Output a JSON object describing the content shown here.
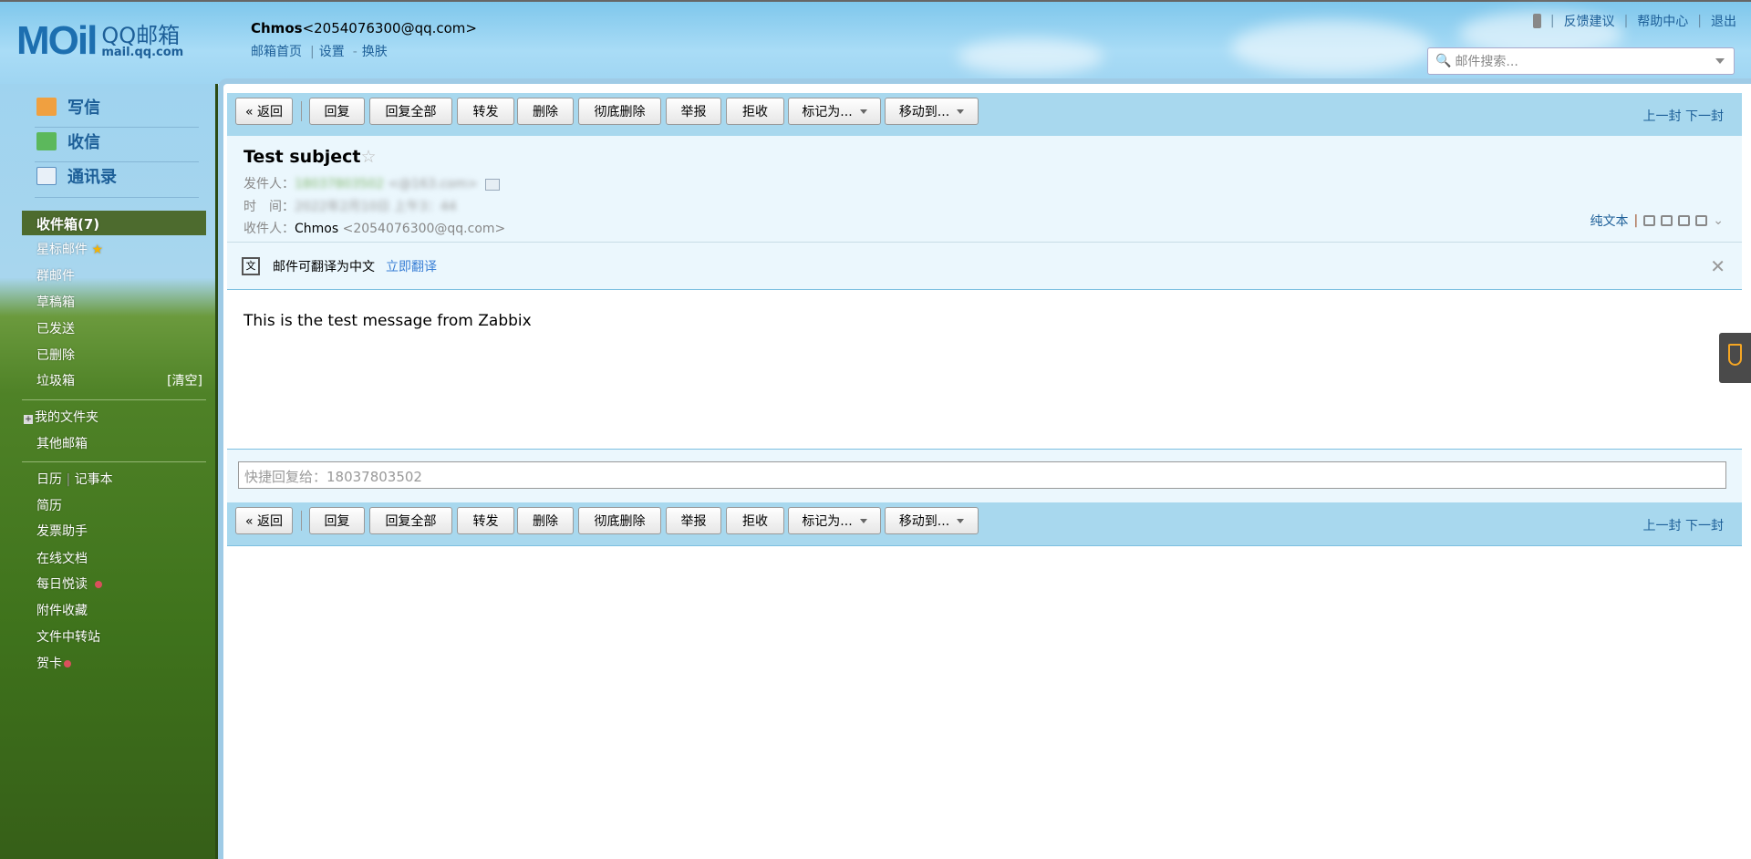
{
  "header": {
    "logo_text": "MOil",
    "logo_brand": "QQ邮箱",
    "logo_domain": "mail.qq.com",
    "user_name": "Chmos",
    "user_email": "<2054076300@qq.com>",
    "links": [
      "邮箱首页",
      "设置",
      "换肤"
    ],
    "right_links": [
      "反馈建议",
      "帮助中心",
      "退出"
    ],
    "search_placeholder": "邮件搜索..."
  },
  "sidebar": {
    "nav": [
      "写信",
      "收信",
      "通讯录"
    ],
    "folders": [
      "收件箱(7)",
      "星标邮件",
      "群邮件",
      "草稿箱",
      "已发送",
      "已删除",
      "垃圾箱"
    ],
    "clear_label": "[清空]",
    "group2": [
      "我的文件夹",
      "其他邮箱"
    ],
    "apps": [
      "日历",
      "记事本",
      "简历",
      "发票助手",
      "在线文档",
      "每日悦读",
      "附件收藏",
      "文件中转站",
      "贺卡"
    ]
  },
  "toolbar": {
    "buttons": [
      "« 返回",
      "回复",
      "回复全部",
      "转发",
      "删除",
      "彻底删除",
      "举报",
      "拒收",
      "标记为...",
      "移动到..."
    ],
    "prev": "上一封",
    "next": "下一封"
  },
  "mail": {
    "subject": "Test subject",
    "from_label": "发件人：",
    "from_name": "18037803502",
    "from_email": "<@163.com>",
    "time_label": "时　间：",
    "time_value": "2022年2月10日 上午3：44",
    "to_label": "收件人：",
    "to_name": "Chmos",
    "to_email": "<2054076300@qq.com>",
    "plain_text": "纯文本",
    "body": "This is the test message from Zabbix"
  },
  "translate": {
    "text": "邮件可翻译为中文",
    "action": "立即翻译"
  },
  "quick_reply": {
    "placeholder": "快捷回复给：18037803502"
  },
  "colors": {
    "accent": "#1d5f98",
    "toolbar": "#a8d8ee",
    "active_folder": "#4d6b2e"
  }
}
